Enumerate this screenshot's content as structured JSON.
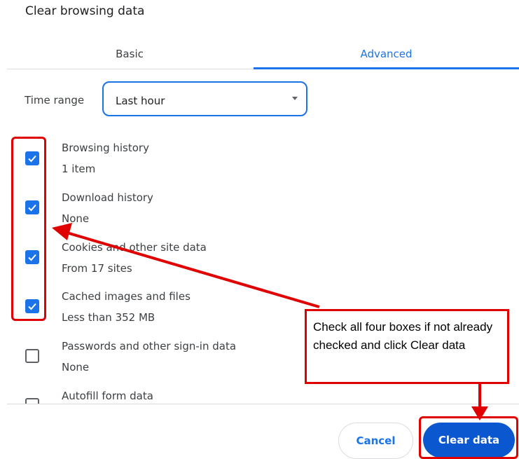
{
  "dialog": {
    "title": "Clear browsing data"
  },
  "tabs": [
    {
      "label": "Basic",
      "active": false
    },
    {
      "label": "Advanced",
      "active": true
    }
  ],
  "time_range": {
    "label": "Time range",
    "value": "Last hour"
  },
  "items": [
    {
      "title": "Browsing history",
      "subtitle": "1 item",
      "checked": true
    },
    {
      "title": "Download history",
      "subtitle": "None",
      "checked": true
    },
    {
      "title": "Cookies and other site data",
      "subtitle": "From 17 sites",
      "checked": true
    },
    {
      "title": "Cached images and files",
      "subtitle": "Less than 352 MB",
      "checked": true
    },
    {
      "title": "Passwords and other sign-in data",
      "subtitle": "None",
      "checked": false
    },
    {
      "title": "Autofill form data",
      "subtitle": "",
      "checked": false
    }
  ],
  "buttons": {
    "cancel": "Cancel",
    "clear": "Clear data"
  },
  "annotation": {
    "text": "Check all four boxes if not already checked and click Clear data"
  },
  "colors": {
    "accent": "#1a73e8",
    "primary_button": "#0b57d0",
    "annotation": "#e00000"
  },
  "icons": {
    "checkbox_checked": "checkmark-icon",
    "dropdown": "caret-down-icon"
  }
}
